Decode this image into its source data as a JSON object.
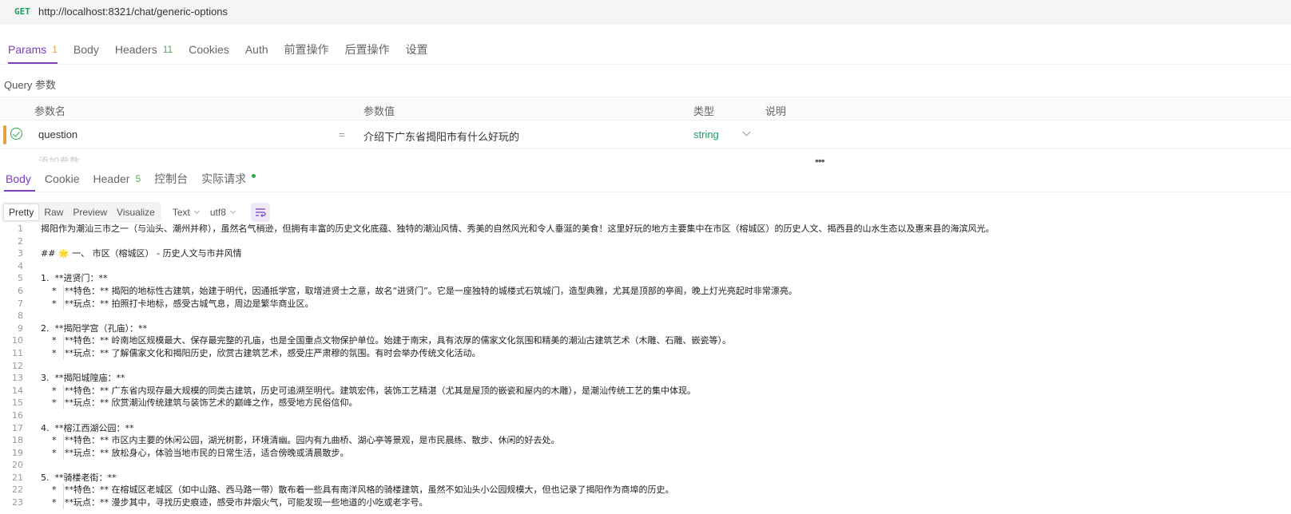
{
  "request": {
    "method": "GET",
    "url": "http://localhost:8321/chat/generic-options"
  },
  "req_tabs": [
    {
      "label": "Params",
      "count": "1",
      "active": true
    },
    {
      "label": "Body"
    },
    {
      "label": "Headers",
      "count": "11"
    },
    {
      "label": "Cookies"
    },
    {
      "label": "Auth"
    },
    {
      "label": "前置操作"
    },
    {
      "label": "后置操作"
    },
    {
      "label": "设置"
    }
  ],
  "query_label": "Query 参数",
  "params_table": {
    "headers": {
      "name": "参数名",
      "value": "参数值",
      "type": "类型",
      "desc": "说明"
    },
    "rows": [
      {
        "name": "question",
        "eq": "=",
        "value": "介绍下广东省揭阳市有什么好玩的",
        "type": "string"
      }
    ],
    "new_row_placeholder": "添加参数"
  },
  "resp_tabs": [
    {
      "label": "Body",
      "active": true
    },
    {
      "label": "Cookie"
    },
    {
      "label": "Header",
      "count": "5"
    },
    {
      "label": "控制台"
    },
    {
      "label": "实际请求",
      "dot": true
    }
  ],
  "format_bar": {
    "modes": [
      "Pretty",
      "Raw",
      "Preview",
      "Visualize"
    ],
    "active_mode": "Pretty",
    "type_select": "Text",
    "encoding_select": "utf8"
  },
  "response_lines": [
    {
      "n": "1",
      "text": "揭阳作为潮汕三市之一（与汕头、潮州并称），虽然名气稍逊，但拥有丰富的历史文化底蕴、独特的潮汕风情、秀美的自然风光和令人垂涎的美食！这里好玩的地方主要集中在市区（榕城区）的历史人文、揭西县的山水生态以及惠来县的海滨风光。"
    },
    {
      "n": "2",
      "text": ""
    },
    {
      "n": "3",
      "text": "## 🌟 一、 市区（榕城区） - 历史人文与市井风情"
    },
    {
      "n": "4",
      "text": ""
    },
    {
      "n": "5",
      "text": "1.  **进贤门：**"
    },
    {
      "n": "6",
      "text": "    *   **特色：** 揭阳的地标性古建筑，始建于明代，因通抵学宫，取增进贤士之意，故名“进贤门”。它是一座独特的城楼式石筑城门，造型典雅，尤其是顶部的亭阁，晚上灯光亮起时非常漂亮。",
      "guide": true
    },
    {
      "n": "7",
      "text": "    *   **玩点：** 拍照打卡地标，感受古城气息，周边是繁华商业区。",
      "guide": true
    },
    {
      "n": "8",
      "text": ""
    },
    {
      "n": "9",
      "text": "2.  **揭阳学宫（孔庙）：**"
    },
    {
      "n": "10",
      "text": "    *   **特色：** 岭南地区规模最大、保存最完整的孔庙，也是全国重点文物保护单位。始建于南宋，具有浓厚的儒家文化氛围和精美的潮汕古建筑艺术（木雕、石雕、嵌瓷等）。",
      "guide": true
    },
    {
      "n": "11",
      "text": "    *   **玩点：** 了解儒家文化和揭阳历史，欣赏古建筑艺术，感受庄严肃穆的氛围。有时会举办传统文化活动。",
      "guide": true
    },
    {
      "n": "12",
      "text": ""
    },
    {
      "n": "13",
      "text": "3.  **揭阳城隍庙：**"
    },
    {
      "n": "14",
      "text": "    *   **特色：** 广东省内现存最大规模的同类古建筑，历史可追溯至明代。建筑宏伟，装饰工艺精湛（尤其是屋顶的嵌瓷和屋内的木雕），是潮汕传统工艺的集中体现。",
      "guide": true
    },
    {
      "n": "15",
      "text": "    *   **玩点：** 欣赏潮汕传统建筑与装饰艺术的巅峰之作，感受地方民俗信仰。",
      "guide": true
    },
    {
      "n": "16",
      "text": ""
    },
    {
      "n": "17",
      "text": "4.  **榕江西湖公园：**"
    },
    {
      "n": "18",
      "text": "    *   **特色：** 市区内主要的休闲公园，湖光树影，环境清幽。园内有九曲桥、湖心亭等景观，是市民晨练、散步、休闲的好去处。",
      "guide": true
    },
    {
      "n": "19",
      "text": "    *   **玩点：** 放松身心，体验当地市民的日常生活，适合傍晚或清晨散步。",
      "guide": true
    },
    {
      "n": "20",
      "text": ""
    },
    {
      "n": "21",
      "text": "5.  **骑楼老街：**"
    },
    {
      "n": "22",
      "text": "    *   **特色：** 在榕城区老城区（如中山路、西马路一带）散布着一些具有南洋风格的骑楼建筑，虽然不如汕头小公园规模大，但也记录了揭阳作为商埠的历史。",
      "guide": true
    },
    {
      "n": "23",
      "text": "    *   **玩点：** 漫步其中，寻找历史痕迹，感受市井烟火气，可能发现一些地道的小吃或老字号。",
      "guide": true
    }
  ]
}
